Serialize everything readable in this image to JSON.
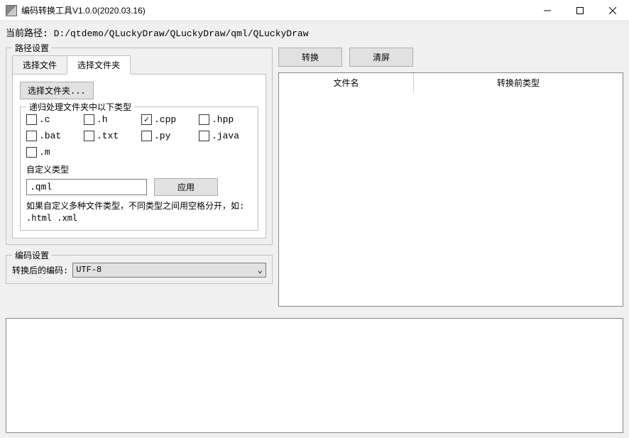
{
  "window": {
    "title": "编码转换工具V1.0.0(2020.03.16)"
  },
  "path": {
    "label": "当前路径:",
    "value": "D:/qtdemo/QLuckyDraw/QLuckyDraw/qml/QLuckyDraw"
  },
  "pathSettings": {
    "title": "路径设置",
    "tabs": {
      "selectFile": "选择文件",
      "selectFolder": "选择文件夹"
    },
    "selectFolderBtn": "选择文件夹...",
    "recursiveGroup": "递归处理文件夹中以下类型",
    "types": {
      "c": ".c",
      "h": ".h",
      "cpp": ".cpp",
      "hpp": ".hpp",
      "bat": ".bat",
      "txt": ".txt",
      "py": ".py",
      "java": ".java",
      "m": ".m"
    },
    "customLabel": "自定义类型",
    "customValue": ".qml",
    "applyBtn": "应用",
    "hint": "如果自定义多种文件类型，不同类型之间用空格分开，如: .html .xml"
  },
  "encSettings": {
    "title": "编码设置",
    "label": "转换后的编码:",
    "value": "UTF-8"
  },
  "actions": {
    "convert": "转换",
    "clear": "清屏"
  },
  "table": {
    "col1": "文件名",
    "col2": "转换前类型"
  }
}
